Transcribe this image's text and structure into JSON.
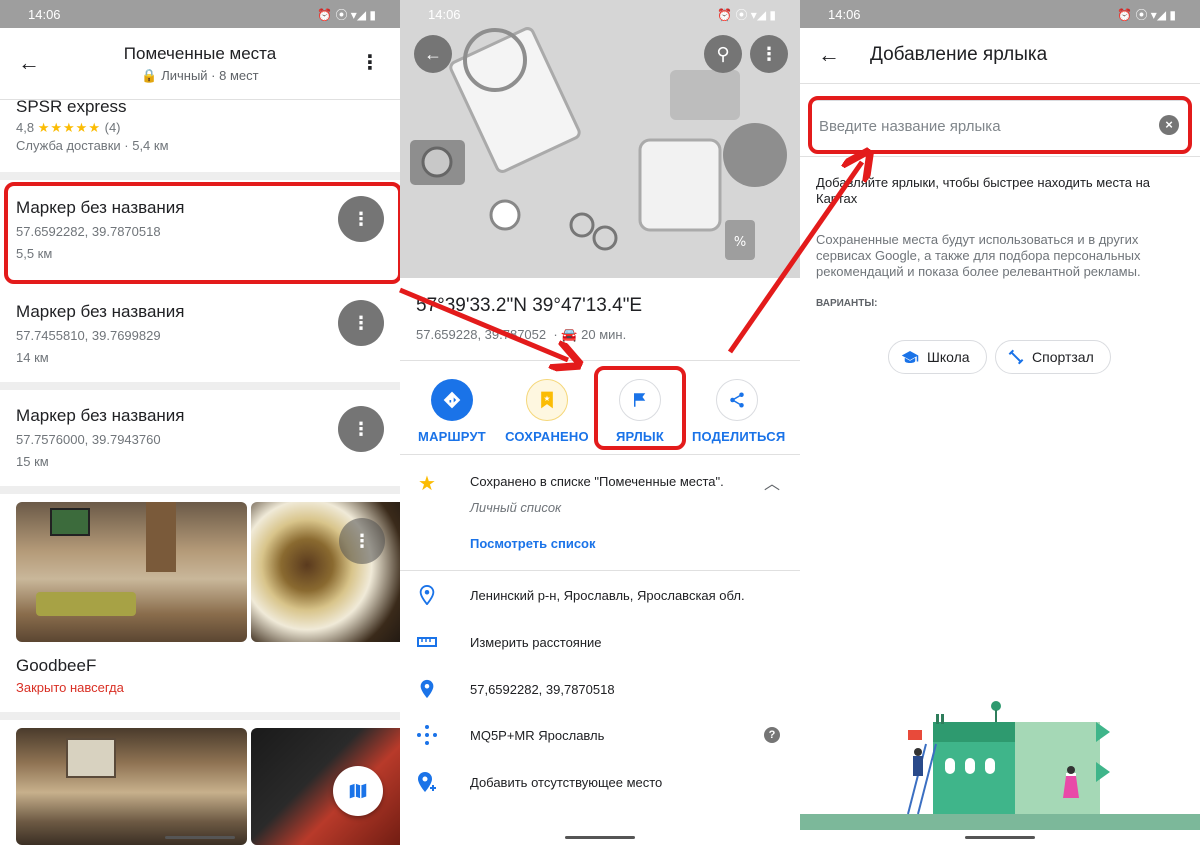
{
  "status_time": "14:06",
  "screen1": {
    "title": "Помеченные места",
    "subtitle": "Личный · 8 мест",
    "items": [
      {
        "title": "SPSR express",
        "rating": "4,8",
        "stars": "★★★★★",
        "reviews": "(4)",
        "detail": "Служба доставки · 5,4 км"
      },
      {
        "title": "Маркер без названия",
        "coords": "57.6592282, 39.7870518",
        "distance": "5,5 км"
      },
      {
        "title": "Маркер без названия",
        "coords": "57.7455810, 39.7699829",
        "distance": "14 км"
      },
      {
        "title": "Маркер без названия",
        "coords": "57.7576000, 39.7943760",
        "distance": "15 км"
      },
      {
        "title": "GoodbeeF",
        "status": "Закрыто навсегда"
      }
    ]
  },
  "screen2": {
    "coords_title": "57°39'33.2\"N 39°47'13.4\"E",
    "coords_decimal": "57.659228, 39.787052",
    "drive_time": "20 мин.",
    "actions": [
      {
        "label": "МАРШРУТ",
        "icon": "directions-icon"
      },
      {
        "label": "СОХРАНЕНО",
        "icon": "saved-icon"
      },
      {
        "label": "ЯРЛЫК",
        "icon": "flag-icon"
      },
      {
        "label": "ПОДЕЛИТЬСЯ",
        "icon": "share-icon"
      }
    ],
    "saved_text": "Сохранено в списке \"Помеченные места\".",
    "saved_sub": "Личный список",
    "view_list": "Посмотреть список",
    "address": "Ленинский р-н, Ярославль, Ярославская обл.",
    "measure": "Измерить расстояние",
    "coords_row": "57,6592282, 39,7870518",
    "plus_code": "MQ5P+MR Ярославль",
    "add_place": "Добавить отсутствующее место"
  },
  "screen3": {
    "title": "Добавление ярлыка",
    "input_placeholder": "Введите название ярлыка",
    "para1": "Добавляйте ярлыки, чтобы быстрее находить места на Картах",
    "para2": "Сохраненные места будут использоваться и в других сервисах Google, а также для подбора персональных рекомендаций и показа более релевантной рекламы.",
    "variants_label": "ВАРИАНТЫ:",
    "chips": [
      "Школа",
      "Спортзал"
    ]
  },
  "colors": {
    "accent": "#1a73e8",
    "highlight": "#e31b1b",
    "star": "#fbbc04",
    "closed": "#d93025"
  }
}
